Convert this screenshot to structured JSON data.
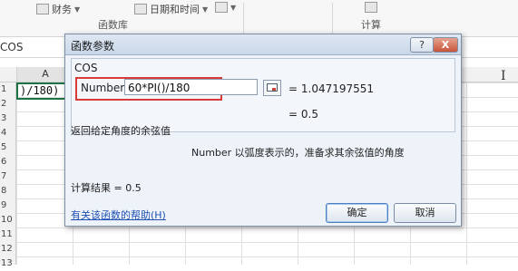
{
  "ribbon": {
    "finance_label": "财务",
    "datetime_label": "日期和时间",
    "group_function_library": "函数库",
    "group_calculation": "计算"
  },
  "formula_bar": {
    "name_box": "COS"
  },
  "sheet": {
    "column_a": "A",
    "rows": [
      "1",
      "2",
      "3",
      "4",
      "5",
      "6",
      "7",
      "8",
      "9",
      "10",
      "11",
      "12",
      "13"
    ],
    "cell_a1_text": ")/180)"
  },
  "dialog": {
    "title": "函数参数",
    "help_button": "?",
    "close_button": "X",
    "function_name": "COS",
    "argument_label": "Number",
    "argument_value": "60*PI()/180",
    "argument_result": "= 1.047197551",
    "function_result": "= 0.5",
    "description": "返回给定角度的余弦值",
    "argument_description": "Number  以弧度表示的，准备求其余弦值的角度",
    "calc_result": "计算结果 =   0.5",
    "help_link": "有关该函数的帮助(H)",
    "ok_button": "确定",
    "cancel_button": "取消"
  }
}
